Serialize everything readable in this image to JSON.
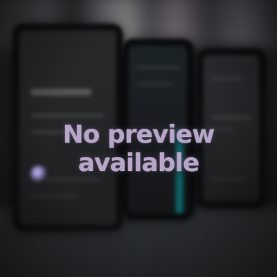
{
  "overlay": {
    "text": "No preview available"
  }
}
